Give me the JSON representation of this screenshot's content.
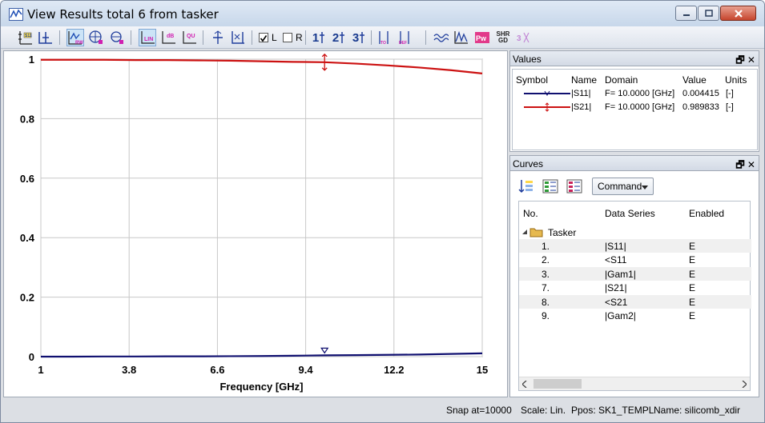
{
  "window": {
    "title": "View Results total 6 from tasker"
  },
  "toolbar": {
    "items": [
      "s11-icon",
      "marker-icon",
      "rw-icon",
      "smith-icon",
      "polar-icon",
      "lin-icon",
      "db-icon",
      "qu-icon",
      "marker-a-icon",
      "marker-b-icon"
    ],
    "lin_label": "LIN",
    "db_label": "dB",
    "qu_label": "QU",
    "check_l_label": "L",
    "check_l_checked": true,
    "check_r_label": "R",
    "check_r_checked": false,
    "marker1_label": "1",
    "marker2_label": "2",
    "marker3_label": "3",
    "shr_label": "SHR GD"
  },
  "chart_data": {
    "type": "line",
    "xlabel": "Frequency [GHz]",
    "ylabel": "",
    "xlim": [
      1,
      15
    ],
    "ylim": [
      0,
      1
    ],
    "x_ticks": [
      "1",
      "3.8",
      "6.6",
      "9.4",
      "12.2",
      "15"
    ],
    "y_ticks": [
      "0",
      "0.2",
      "0.4",
      "0.6",
      "0.8",
      "1"
    ],
    "grid": true,
    "series": [
      {
        "name": "|S21|",
        "color": "#cc1111",
        "x": [
          1,
          2,
          3,
          4,
          5,
          6,
          7,
          8,
          9,
          10,
          11,
          12,
          13,
          14,
          15
        ],
        "values": [
          0.998,
          0.998,
          0.998,
          0.997,
          0.997,
          0.996,
          0.995,
          0.993,
          0.991,
          0.9898,
          0.985,
          0.979,
          0.972,
          0.963,
          0.952
        ]
      },
      {
        "name": "|S11|",
        "color": "#101070",
        "x": [
          1,
          2,
          3,
          4,
          5,
          6,
          7,
          8,
          9,
          10,
          11,
          12,
          13,
          14,
          15
        ],
        "values": [
          0.0,
          0.0,
          0.0005,
          0.0005,
          0.001,
          0.001,
          0.0015,
          0.002,
          0.003,
          0.0044,
          0.005,
          0.006,
          0.007,
          0.009,
          0.011
        ]
      }
    ],
    "marker_x": 10.0
  },
  "values_panel": {
    "title": "Values",
    "headers": [
      "Symbol",
      "Name",
      "Domain",
      "Value",
      "Units"
    ],
    "rows": [
      {
        "name": "|S11|",
        "domain": "F= 10.0000 [GHz]",
        "value": "0.004415",
        "units": "[-]",
        "color": "#101070"
      },
      {
        "name": "|S21|",
        "domain": "F= 10.0000 [GHz]",
        "value": "0.989833",
        "units": "[-]",
        "color": "#cc1111"
      }
    ]
  },
  "curves_panel": {
    "title": "Curves",
    "command_label": "Command",
    "headers": [
      "No.",
      "Data Series",
      "Enabled"
    ],
    "group": "Tasker",
    "rows": [
      {
        "no": "1.",
        "series": "|S11|",
        "enabled": "E"
      },
      {
        "no": "2.",
        "series": "<S11",
        "enabled": "E"
      },
      {
        "no": "3.",
        "series": "|Gam1|",
        "enabled": "E"
      },
      {
        "no": "7.",
        "series": "|S21|",
        "enabled": "E"
      },
      {
        "no": "8.",
        "series": "<S21",
        "enabled": "E"
      },
      {
        "no": "9.",
        "series": "|Gam2|",
        "enabled": "E"
      }
    ]
  },
  "status": {
    "snap": "Snap at=10000",
    "scale": "Scale: Lin.",
    "ppos": "Ppos: SK1_TEMPL",
    "name": "Name: silicomb_xdir"
  },
  "dock_buttons": "🗗 ✕"
}
